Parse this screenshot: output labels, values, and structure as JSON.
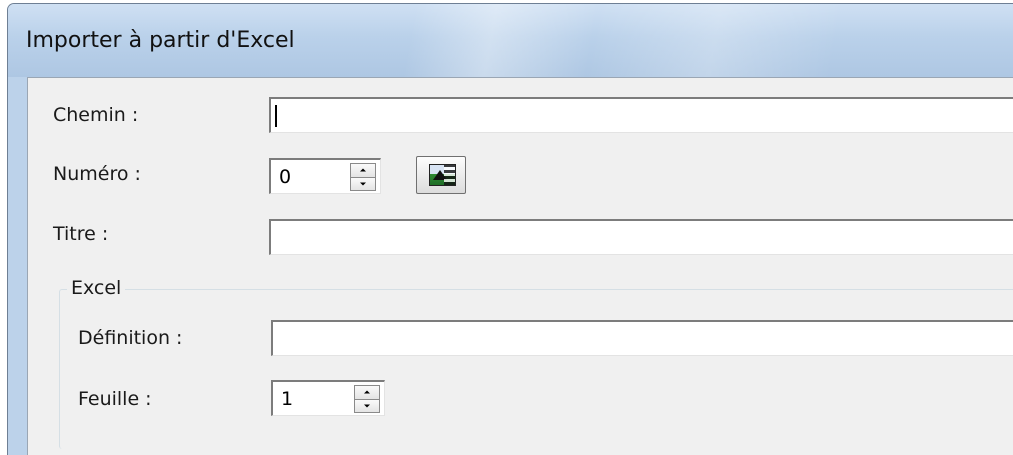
{
  "window": {
    "title": "Importer à partir d'Excel"
  },
  "form": {
    "path_label": "Chemin :",
    "path_value": "",
    "number_label": "Numéro :",
    "number_value": "0",
    "title_label": "Titre :",
    "title_value": ""
  },
  "excel_group": {
    "legend": "Excel",
    "definition_label": "Définition :",
    "definition_value": "",
    "sheet_label": "Feuille :",
    "sheet_value": "1"
  },
  "icons": {
    "preview_button_icon": "picture-icon"
  }
}
